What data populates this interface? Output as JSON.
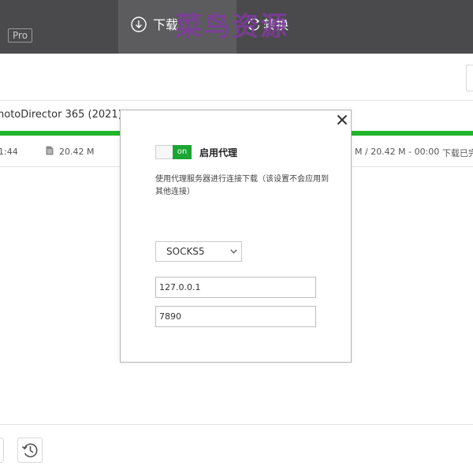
{
  "header": {
    "pro_badge": "Pro",
    "tabs": [
      {
        "label": "下载",
        "icon": "download-circle-icon",
        "active": true
      },
      {
        "label": "转换",
        "icon": "convert-icon",
        "active": false
      }
    ],
    "watermark": "菜鸟资源"
  },
  "task": {
    "title": "hotoDirector 365 (2021) -",
    "progress_percent": 100,
    "time_left": "1:44",
    "file_size": "20.42 M",
    "transfer_status": "M / 20.42 M - 00:00",
    "state": "下载已完"
  },
  "proxy_dialog": {
    "toggle_state": "on",
    "enable_label": "启用代理",
    "description": "使用代理服务器进行连接下载（该设置不会应用到其他连接）",
    "protocol": "SOCKS5",
    "host": "127.0.0.1",
    "port": "7890"
  },
  "colors": {
    "header_bg": "#4a4a4c",
    "active_tab_bg": "#5c5c5e",
    "progress_green": "#20b52a",
    "toggle_on": "#1aa534",
    "watermark_purple": "#803aa0"
  },
  "icons": {
    "close": "close-icon",
    "file": "file-icon",
    "history": "history-icon",
    "select_arrow": "chevron-down-icon"
  }
}
